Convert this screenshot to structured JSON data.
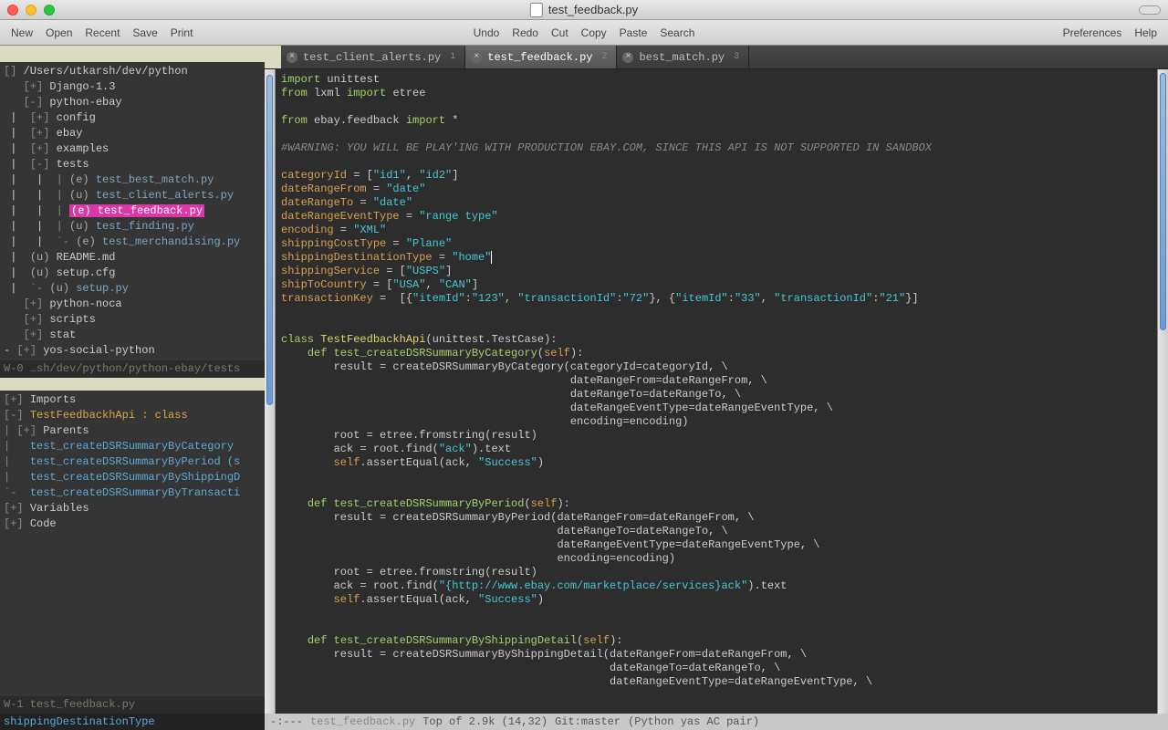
{
  "titlebar": {
    "title": "test_feedback.py"
  },
  "toolbar": {
    "left": [
      "New",
      "Open",
      "Recent",
      "Save",
      "Print"
    ],
    "mid": [
      "Undo",
      "Redo",
      "Cut",
      "Copy",
      "Paste",
      "Search"
    ],
    "right": [
      "Preferences",
      "Help"
    ]
  },
  "tree": {
    "root_marker": "[]",
    "root": "/Users/utkarsh/dev/python",
    "items": [
      {
        "depth": 1,
        "exp": "[+]",
        "name": "Django-1.3",
        "cls": ""
      },
      {
        "depth": 1,
        "exp": "[-]",
        "name": "python-ebay",
        "cls": ""
      },
      {
        "depth": 2,
        "exp": "[+]",
        "name": "config",
        "cls": ""
      },
      {
        "depth": 2,
        "exp": "[+]",
        "name": "ebay",
        "cls": ""
      },
      {
        "depth": 2,
        "exp": "[+]",
        "name": "examples",
        "cls": ""
      },
      {
        "depth": 2,
        "exp": "[-]",
        "name": "tests",
        "cls": ""
      },
      {
        "depth": 3,
        "exp": "|",
        "tag": "(e)",
        "name": "test_best_match.py",
        "cls": "tree-py"
      },
      {
        "depth": 3,
        "exp": "|",
        "tag": "(u)",
        "name": "test_client_alerts.py",
        "cls": "tree-py"
      },
      {
        "depth": 3,
        "exp": "|",
        "tag": "(e)",
        "name": "test_feedback.py",
        "cls": "tree-py",
        "current": true
      },
      {
        "depth": 3,
        "exp": "|",
        "tag": "(u)",
        "name": "test_finding.py",
        "cls": "tree-py"
      },
      {
        "depth": 3,
        "exp": "`-",
        "tag": "(e)",
        "name": "test_merchandising.py",
        "cls": "tree-py"
      },
      {
        "depth": 2,
        "exp": "",
        "tag": "(u)",
        "name": "README.md",
        "cls": ""
      },
      {
        "depth": 2,
        "exp": "",
        "tag": "(u)",
        "name": "setup.cfg",
        "cls": ""
      },
      {
        "depth": 2,
        "exp": "`-",
        "tag": "(u)",
        "name": "setup.py",
        "cls": "tree-py"
      },
      {
        "depth": 1,
        "exp": "[+]",
        "name": "python-noca",
        "cls": ""
      },
      {
        "depth": 1,
        "exp": "[+]",
        "name": "scripts",
        "cls": ""
      },
      {
        "depth": 1,
        "exp": "[+]",
        "name": "stat",
        "cls": ""
      },
      {
        "depth": 1,
        "exp": "[+]",
        "name": "yos-social-python",
        "cls": "",
        "prefix": "- "
      }
    ],
    "status": "W-0 …sh/dev/python/python-ebay/tests"
  },
  "outline": {
    "items": [
      {
        "exp": "[+]",
        "label": "Imports",
        "cls": "outline-key"
      },
      {
        "exp": "[-]",
        "label": "TestFeedbackhApi : class",
        "cls": "outline-header"
      },
      {
        "exp": "| [+]",
        "label": "Parents",
        "cls": "outline-key"
      },
      {
        "exp": "|  ",
        "label": "test_createDSRSummaryByCategory",
        "cls": "outline-fn"
      },
      {
        "exp": "|  ",
        "label": "test_createDSRSummaryByPeriod (s",
        "cls": "outline-fn"
      },
      {
        "exp": "|  ",
        "label": "test_createDSRSummaryByShippingD",
        "cls": "outline-fn"
      },
      {
        "exp": "`- ",
        "label": "test_createDSRSummaryByTransacti",
        "cls": "outline-fn"
      },
      {
        "exp": "[+]",
        "label": "Variables",
        "cls": "outline-key"
      },
      {
        "exp": "[+]",
        "label": "Code",
        "cls": "outline-key"
      }
    ],
    "status": "W-1 test_feedback.py",
    "minibuffer": "shippingDestinationType"
  },
  "tabs": [
    {
      "name": "test_client_alerts.py",
      "num": "1",
      "active": false
    },
    {
      "name": "test_feedback.py",
      "num": "2",
      "active": true
    },
    {
      "name": "best_match.py",
      "num": "3",
      "active": false
    }
  ],
  "status": {
    "flags": "-:---",
    "file": "test_feedback.py",
    "pos": "Top of 2.9k (14,32)",
    "git": "Git:master",
    "modes": "(Python yas AC pair)"
  },
  "code_lines": [
    [
      [
        "kw",
        "import"
      ],
      [
        "op",
        " "
      ],
      [
        "mod",
        "unittest"
      ]
    ],
    [
      [
        "kw",
        "from"
      ],
      [
        "op",
        " "
      ],
      [
        "mod",
        "lxml"
      ],
      [
        "op",
        " "
      ],
      [
        "kw",
        "import"
      ],
      [
        "op",
        " "
      ],
      [
        "mod",
        "etree"
      ]
    ],
    [],
    [
      [
        "kw",
        "from"
      ],
      [
        "op",
        " "
      ],
      [
        "mod",
        "ebay.feedback"
      ],
      [
        "op",
        " "
      ],
      [
        "kw",
        "import"
      ],
      [
        "op",
        " "
      ],
      [
        "op",
        "*"
      ]
    ],
    [],
    [
      [
        "cm",
        "#WARNING: YOU WILL BE PLAY'ING WITH PRODUCTION EBAY.COM, SINCE THIS API IS NOT SUPPORTED IN SANDBOX"
      ]
    ],
    [],
    [
      [
        "var",
        "categoryId"
      ],
      [
        "op",
        " = ["
      ],
      [
        "str",
        "\"id1\""
      ],
      [
        "op",
        ", "
      ],
      [
        "str",
        "\"id2\""
      ],
      [
        "op",
        "]"
      ]
    ],
    [
      [
        "var",
        "dateRangeFrom"
      ],
      [
        "op",
        " = "
      ],
      [
        "str",
        "\"date\""
      ]
    ],
    [
      [
        "var",
        "dateRangeTo"
      ],
      [
        "op",
        " = "
      ],
      [
        "str",
        "\"date\""
      ]
    ],
    [
      [
        "var",
        "dateRangeEventType"
      ],
      [
        "op",
        " = "
      ],
      [
        "str",
        "\"range type\""
      ]
    ],
    [
      [
        "var",
        "encoding"
      ],
      [
        "op",
        " = "
      ],
      [
        "str",
        "\"XML\""
      ]
    ],
    [
      [
        "var",
        "shippingCostType"
      ],
      [
        "op",
        " = "
      ],
      [
        "str",
        "\"Plane\""
      ]
    ],
    [
      [
        "var",
        "shippingDestinationType"
      ],
      [
        "op",
        " = "
      ],
      [
        "str",
        "\"home\""
      ],
      [
        "caret",
        ""
      ]
    ],
    [
      [
        "var",
        "shippingService"
      ],
      [
        "op",
        " = ["
      ],
      [
        "str",
        "\"USPS\""
      ],
      [
        "op",
        "]"
      ]
    ],
    [
      [
        "var",
        "shipToCountry"
      ],
      [
        "op",
        " = ["
      ],
      [
        "str",
        "\"USA\""
      ],
      [
        "op",
        ", "
      ],
      [
        "str",
        "\"CAN\""
      ],
      [
        "op",
        "]"
      ]
    ],
    [
      [
        "var",
        "transactionKey"
      ],
      [
        "op",
        " =  [{"
      ],
      [
        "str",
        "\"itemId\""
      ],
      [
        "op",
        ":"
      ],
      [
        "str",
        "\"123\""
      ],
      [
        "op",
        ", "
      ],
      [
        "str",
        "\"transactionId\""
      ],
      [
        "op",
        ":"
      ],
      [
        "str",
        "\"72\""
      ],
      [
        "op",
        "}, {"
      ],
      [
        "str",
        "\"itemId\""
      ],
      [
        "op",
        ":"
      ],
      [
        "str",
        "\"33\""
      ],
      [
        "op",
        ", "
      ],
      [
        "str",
        "\"transactionId\""
      ],
      [
        "op",
        ":"
      ],
      [
        "str",
        "\"21\""
      ],
      [
        "op",
        "}]"
      ]
    ],
    [],
    [],
    [
      [
        "kw",
        "class"
      ],
      [
        "op",
        " "
      ],
      [
        "cls",
        "TestFeedbackhApi"
      ],
      [
        "op",
        "("
      ],
      [
        "builtin",
        "unittest.TestCase"
      ],
      [
        "op",
        "):"
      ]
    ],
    [
      [
        "op",
        "    "
      ],
      [
        "kw",
        "def"
      ],
      [
        "op",
        " "
      ],
      [
        "fn",
        "test_createDSRSummaryByCategory"
      ],
      [
        "op",
        "("
      ],
      [
        "self",
        "self"
      ],
      [
        "op",
        "):"
      ]
    ],
    [
      [
        "op",
        "        result = createDSRSummaryByCategory(categoryId=categoryId, \\"
      ]
    ],
    [
      [
        "op",
        "                                            dateRangeFrom=dateRangeFrom, \\"
      ]
    ],
    [
      [
        "op",
        "                                            dateRangeTo=dateRangeTo, \\"
      ]
    ],
    [
      [
        "op",
        "                                            dateRangeEventType=dateRangeEventType, \\"
      ]
    ],
    [
      [
        "op",
        "                                            encoding=encoding)"
      ]
    ],
    [
      [
        "op",
        "        root = etree.fromstring(result)"
      ]
    ],
    [
      [
        "op",
        "        ack = root.find("
      ],
      [
        "str",
        "\"ack\""
      ],
      [
        "op",
        ").text"
      ]
    ],
    [
      [
        "op",
        "        "
      ],
      [
        "self",
        "self"
      ],
      [
        "op",
        ".assertEqual(ack, "
      ],
      [
        "str",
        "\"Success\""
      ],
      [
        "op",
        ")"
      ]
    ],
    [],
    [],
    [
      [
        "op",
        "    "
      ],
      [
        "kw",
        "def"
      ],
      [
        "op",
        " "
      ],
      [
        "fn",
        "test_createDSRSummaryByPeriod"
      ],
      [
        "op",
        "("
      ],
      [
        "self",
        "self"
      ],
      [
        "op",
        "):"
      ]
    ],
    [
      [
        "op",
        "        result = createDSRSummaryByPeriod(dateRangeFrom=dateRangeFrom, \\"
      ]
    ],
    [
      [
        "op",
        "                                          dateRangeTo=dateRangeTo, \\"
      ]
    ],
    [
      [
        "op",
        "                                          dateRangeEventType=dateRangeEventType, \\"
      ]
    ],
    [
      [
        "op",
        "                                          encoding=encoding)"
      ]
    ],
    [
      [
        "op",
        "        root = etree.fromstring(result)"
      ]
    ],
    [
      [
        "op",
        "        ack = root.find("
      ],
      [
        "str",
        "\"{http://www.ebay.com/marketplace/services}ack\""
      ],
      [
        "op",
        ").text"
      ]
    ],
    [
      [
        "op",
        "        "
      ],
      [
        "self",
        "self"
      ],
      [
        "op",
        ".assertEqual(ack, "
      ],
      [
        "str",
        "\"Success\""
      ],
      [
        "op",
        ")"
      ]
    ],
    [],
    [],
    [
      [
        "op",
        "    "
      ],
      [
        "kw",
        "def"
      ],
      [
        "op",
        " "
      ],
      [
        "fn",
        "test_createDSRSummaryByShippingDetail"
      ],
      [
        "op",
        "("
      ],
      [
        "self",
        "self"
      ],
      [
        "op",
        "):"
      ]
    ],
    [
      [
        "op",
        "        result = createDSRSummaryByShippingDetail(dateRangeFrom=dateRangeFrom, \\"
      ]
    ],
    [
      [
        "op",
        "                                                  dateRangeTo=dateRangeTo, \\"
      ]
    ],
    [
      [
        "op",
        "                                                  dateRangeEventType=dateRangeEventType, \\"
      ]
    ]
  ]
}
